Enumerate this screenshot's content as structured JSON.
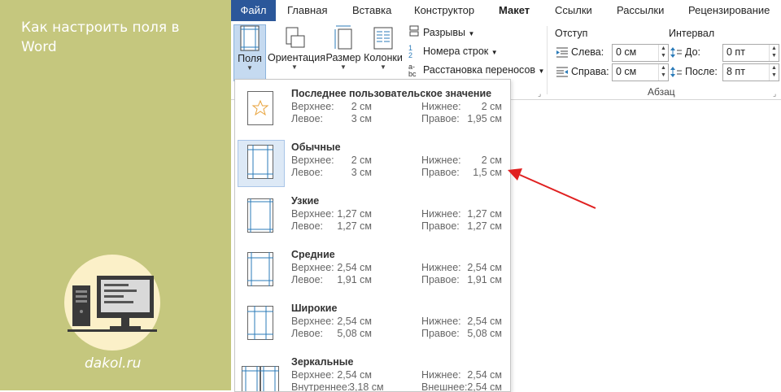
{
  "article": {
    "title": "Как настроить поля в Word",
    "site": "dakol.ru"
  },
  "tabs": [
    "Файл",
    "Главная",
    "Вставка",
    "Конструктор",
    "Макет",
    "Ссылки",
    "Рассылки",
    "Рецензирование"
  ],
  "active_tab": "Макет",
  "ribbon": {
    "fields_label": "Поля",
    "orientation_label": "Ориентация",
    "size_label": "Размер",
    "columns_label": "Колонки",
    "breaks_label": "Разрывы",
    "line_numbers_label": "Номера строк",
    "hyphenation_label": "Расстановка переносов",
    "indent": {
      "title": "Отступ",
      "left_label": "Слева:",
      "left_value": "0 см",
      "right_label": "Справа:",
      "right_value": "0 см"
    },
    "spacing": {
      "title": "Интервал",
      "before_label": "До:",
      "before_value": "0 пт",
      "after_label": "После:",
      "after_value": "8 пт"
    },
    "paragraph_group": "Абзац"
  },
  "margins_menu": [
    {
      "name": "Последнее пользовательское значение",
      "top_label": "Верхнее:",
      "top": "2 см",
      "bottom_label": "Нижнее:",
      "bottom": "2 см",
      "left_label": "Левое:",
      "left": "3 см",
      "right_label": "Правое:",
      "right": "1,95 см",
      "icon": "star-page-icon"
    },
    {
      "name": "Обычные",
      "top_label": "Верхнее:",
      "top": "2 см",
      "bottom_label": "Нижнее:",
      "bottom": "2 см",
      "left_label": "Левое:",
      "left": "3 см",
      "right_label": "Правое:",
      "right": "1,5 см",
      "icon": "page-margins-icon",
      "selected": true
    },
    {
      "name": "Узкие",
      "top_label": "Верхнее:",
      "top": "1,27 см",
      "bottom_label": "Нижнее:",
      "bottom": "1,27 см",
      "left_label": "Левое:",
      "left": "1,27 см",
      "right_label": "Правое:",
      "right": "1,27 см",
      "icon": "page-margins-icon"
    },
    {
      "name": "Средние",
      "top_label": "Верхнее:",
      "top": "2,54 см",
      "bottom_label": "Нижнее:",
      "bottom": "2,54 см",
      "left_label": "Левое:",
      "left": "1,91 см",
      "right_label": "Правое:",
      "right": "1,91 см",
      "icon": "page-margins-icon"
    },
    {
      "name": "Широкие",
      "top_label": "Верхнее:",
      "top": "2,54 см",
      "bottom_label": "Нижнее:",
      "bottom": "2,54 см",
      "left_label": "Левое:",
      "left": "5,08 см",
      "right_label": "Правое:",
      "right": "5,08 см",
      "icon": "page-margins-icon"
    },
    {
      "name": "Зеркальные",
      "top_label": "Верхнее:",
      "top": "2,54 см",
      "bottom_label": "Нижнее:",
      "bottom": "2,54 см",
      "left_label": "Внутреннее:",
      "left": "3,18 см",
      "right_label": "Внешнее:",
      "right": "2,54 см",
      "icon": "mirrored-pages-icon"
    }
  ],
  "colors": {
    "accent": "#2b579a",
    "panel": "#c5c77e",
    "pointer": "#e02020"
  }
}
